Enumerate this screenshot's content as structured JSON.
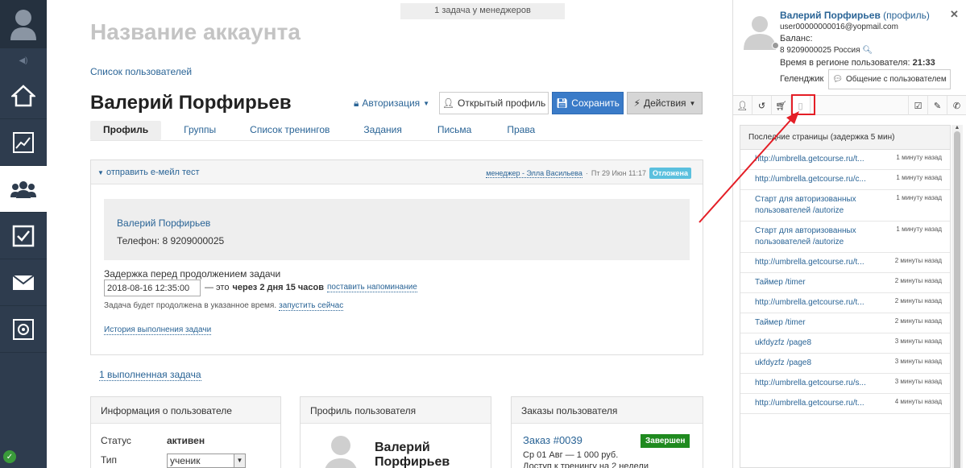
{
  "banner": {
    "text": "1 задача у менеджеров"
  },
  "main": {
    "account_title": "Название аккаунта",
    "user_list_link": "Список пользователей",
    "user_name": "Валерий Порфирьев",
    "buttons": {
      "auth": "Авторизация",
      "open_profile": "Открытый профиль",
      "save": "Сохранить",
      "actions": "Действия"
    },
    "tabs": [
      {
        "label": "Профиль",
        "active": true
      },
      {
        "label": "Группы"
      },
      {
        "label": "Список тренингов"
      },
      {
        "label": "Задания"
      },
      {
        "label": "Письма"
      },
      {
        "label": "Права"
      }
    ],
    "task": {
      "title": "отправить е-мейл тест",
      "manager": "менеджер - Элла Васильева",
      "date": "Пт 29 Июн 11:17",
      "status": "Отложена",
      "contact_name": "Валерий Порфирьев",
      "contact_phone": "Телефон: 8 9209000025",
      "delay_label": "Задержка перед продолжением задачи",
      "delay_value": "2018-08-16 12:35:00",
      "delay_prefix": "— это",
      "delay_bold": "через 2 дня 15 часов",
      "set_reminder": "поставить напоминание",
      "note_text": "Задача будет продолжена в указанное время.",
      "run_now": "запустить сейчас",
      "history": "История выполнения задачи"
    },
    "done_tasks_link": "1 выполненная задача",
    "cards": {
      "info": {
        "title": "Информация о пользователе",
        "status_label": "Статус",
        "status_value": "активен",
        "type_label": "Тип",
        "type_value": "ученик"
      },
      "profile": {
        "title": "Профиль пользователя",
        "name": "Валерий Порфирьев"
      },
      "orders": {
        "title": "Заказы пользователя",
        "order_link": "Заказ #0039",
        "order_status": "Завершен",
        "order_line1": "Ср 01 Авг — 1 000 руб.",
        "order_line2": "Доступ к тренингу на 2 недели"
      }
    }
  },
  "right_panel": {
    "name": "Валерий Порфирьев",
    "profile_link": "(профиль)",
    "email": "user00000000016@yopmail.com",
    "balance_label": "Баланс:",
    "phone": "8 9209000025 Россия",
    "time_label": "Время в регионе пользователя:",
    "time_value": "21:33",
    "gelendzhik": "Геленджик",
    "chat_button": "Общение с пользователем",
    "list_title": "Последние страницы (задержка 5 мин)",
    "pages": [
      {
        "page": "http://umbrella.getcourse.ru/t...",
        "ago": "1 минуту назад"
      },
      {
        "page": "http://umbrella.getcourse.ru/c...",
        "ago": "1 минуту назад"
      },
      {
        "page": "Старт для авторизованных пользователей /autorize",
        "ago": "1 минуту назад"
      },
      {
        "page": "Старт для авторизованных пользователей /autorize",
        "ago": "1 минуту назад"
      },
      {
        "page": "http://umbrella.getcourse.ru/t...",
        "ago": "2 минуты назад"
      },
      {
        "page": "Таймер /timer",
        "ago": "2 минуты назад"
      },
      {
        "page": "http://umbrella.getcourse.ru/t...",
        "ago": "2 минуты назад"
      },
      {
        "page": "Таймер /timer",
        "ago": "2 минуты назад"
      },
      {
        "page": "ukfdyzfz /page8",
        "ago": "3 минуты назад"
      },
      {
        "page": "ukfdyzfz /page8",
        "ago": "3 минуты назад"
      },
      {
        "page": "http://umbrella.getcourse.ru/s...",
        "ago": "3 минуты назад"
      },
      {
        "page": "http://umbrella.getcourse.ru/t...",
        "ago": "4 минуты назад"
      }
    ]
  },
  "colors": {
    "accent": "#3a7bc8",
    "sidebar": "#2e3c4e",
    "annotation": "#e41e26",
    "done": "#1f8a1f",
    "postponed": "#5bc0de"
  }
}
